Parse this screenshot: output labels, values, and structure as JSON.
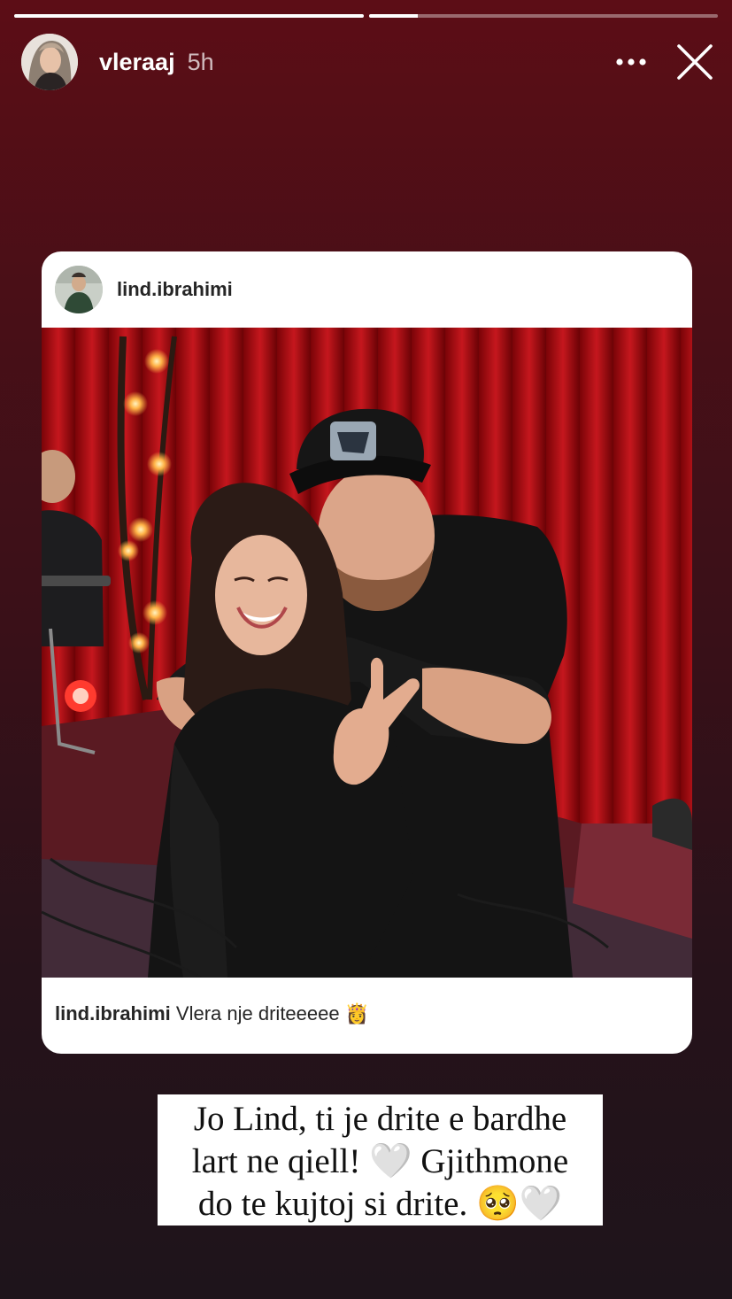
{
  "story": {
    "progress": [
      1.0,
      0.14
    ],
    "username": "vleraaj",
    "time": "5h"
  },
  "icons": {
    "more": "more-horizontal-icon",
    "close": "close-icon"
  },
  "shared_post": {
    "username": "lind.ibrahimi",
    "caption_user": "lind.ibrahimi",
    "caption_text": "Vlera nje driteeeee 👸"
  },
  "text_sticker": {
    "line1": "Jo Lind, ti je drite e bardhe",
    "line2": "lart ne qiell! 🤍 Gjithmone",
    "line3": "do te kujtoj si drite. 🥺🤍"
  },
  "colors": {
    "background_top": "#5c0d16",
    "background_bottom": "#1e141b",
    "curtain": "#c4121a"
  }
}
